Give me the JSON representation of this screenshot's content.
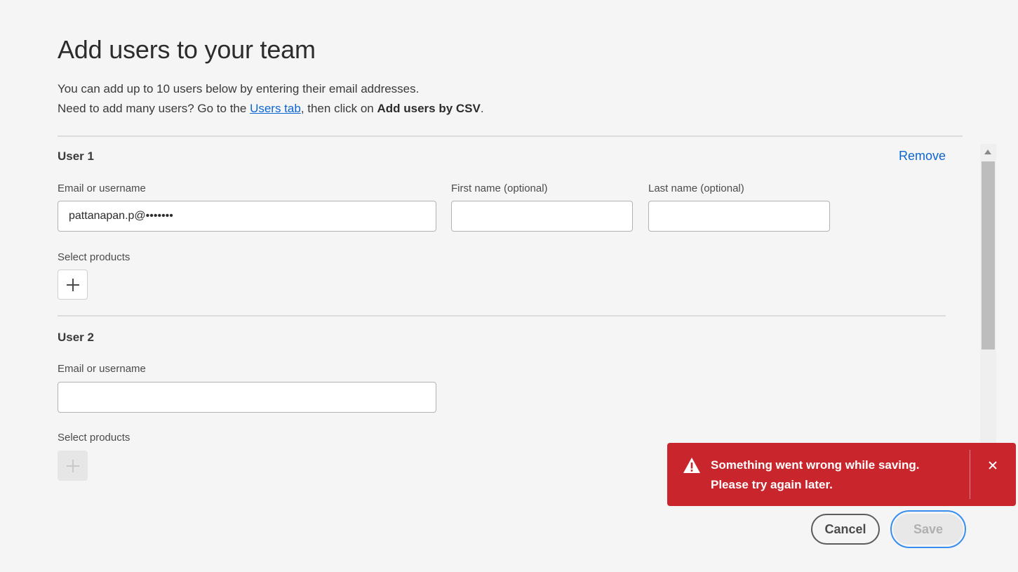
{
  "header": {
    "title": "Add users to your team",
    "intro_line1": "You can add up to 10 users below by entering their email addresses.",
    "intro_line2_prefix": "Need to add many users? Go to the ",
    "intro_link": "Users tab",
    "intro_line2_mid": ", then click on ",
    "intro_bold": "Add users by CSV",
    "intro_line2_suffix": "."
  },
  "users": [
    {
      "heading": "User 1",
      "remove_label": "Remove",
      "email_label": "Email or username",
      "email_value": "pattanapan.p@•••••••",
      "first_name_label": "First name (optional)",
      "first_name_value": "",
      "last_name_label": "Last name (optional)",
      "last_name_value": "",
      "products_label": "Select products",
      "add_products_enabled": true
    },
    {
      "heading": "User 2",
      "email_label": "Email or username",
      "email_value": "",
      "products_label": "Select products",
      "add_products_enabled": false
    }
  ],
  "toast": {
    "type": "error",
    "line1": "Something went wrong while saving.",
    "line2": "Please try again later.",
    "icon": "alert-triangle-icon",
    "close_icon": "close-icon",
    "color": "#c9252d"
  },
  "footer": {
    "cancel_label": "Cancel",
    "save_label": "Save",
    "save_enabled": false
  },
  "colors": {
    "link": "#0d66d0",
    "background": "#f5f5f5",
    "focus_ring": "#378ef0"
  }
}
